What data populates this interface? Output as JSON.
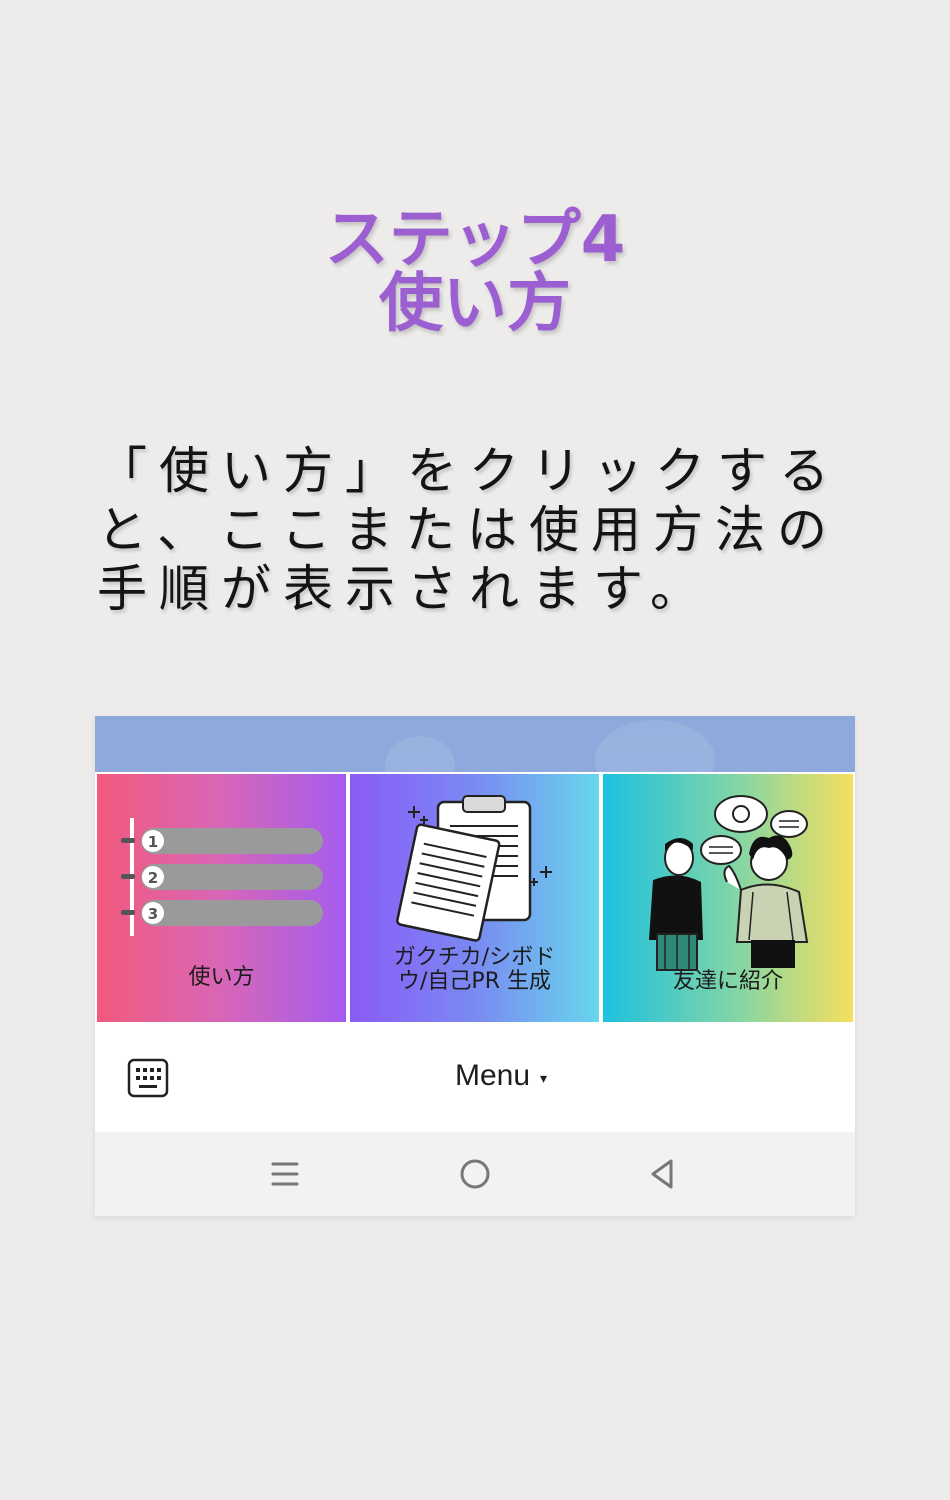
{
  "title": {
    "line1": "ステップ4",
    "line2": "使い方"
  },
  "description": {
    "line1": "「使い方」をクリックする",
    "line2": "と、ここまたは使用方法の",
    "line3": "手順が表示されます。"
  },
  "screenshot": {
    "tiles": [
      {
        "label_lines": [
          "使い方"
        ],
        "icon": "numbered-list-icon",
        "steps": [
          "1",
          "2",
          "3"
        ]
      },
      {
        "label_lines": [
          "ガクチカ/シボド",
          "ウ/自己PR 生成"
        ],
        "icon": "documents-clipboard-icon"
      },
      {
        "label_lines": [
          "友達に紹介"
        ],
        "icon": "two-people-talking-icon"
      }
    ],
    "menubar": {
      "keyboard_icon": "keyboard-icon",
      "menu_label": "Menu",
      "menu_caret": "▾"
    },
    "navbar": {
      "icons": [
        "menu-lines-icon",
        "home-circle-icon",
        "back-triangle-icon"
      ]
    }
  },
  "colors": {
    "title": "#9b5fd2",
    "background": "#edecea",
    "topbar": "#8ea9db"
  }
}
